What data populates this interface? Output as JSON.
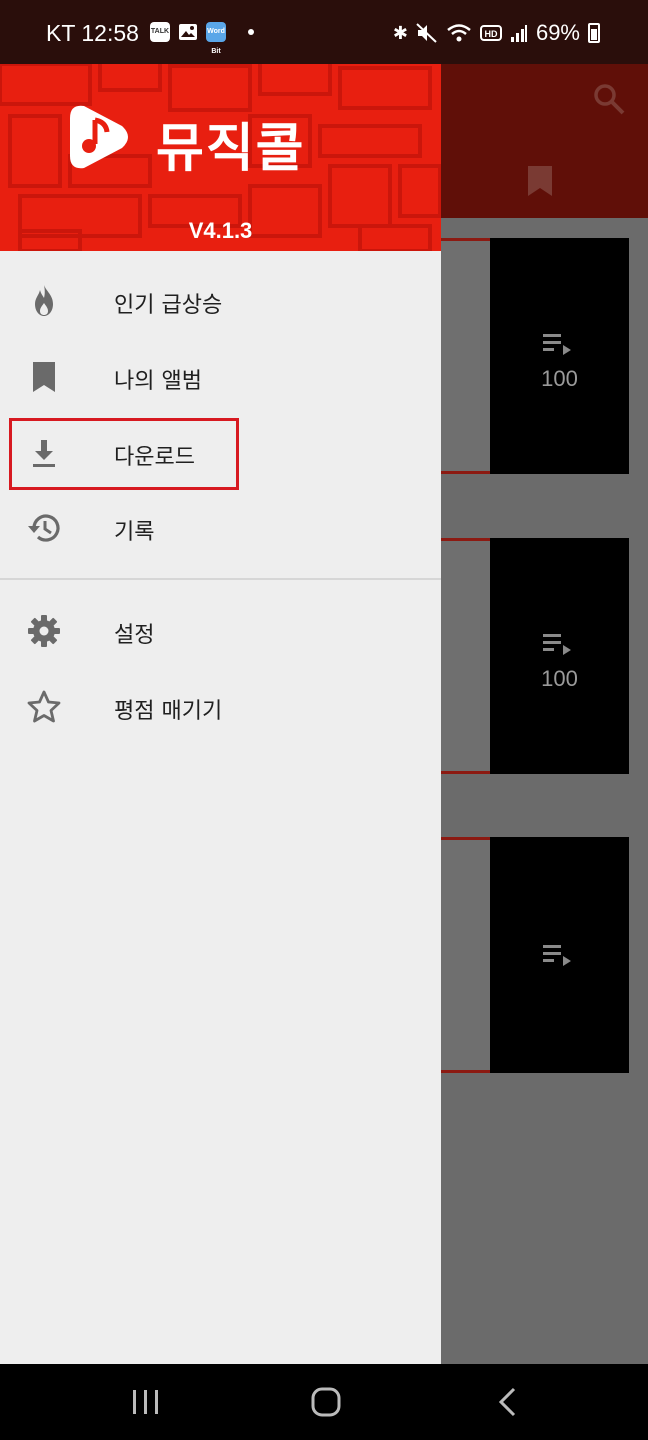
{
  "status_bar": {
    "carrier_time": "KT 12:58",
    "notif_icons": [
      "talk-icon",
      "image-icon",
      "wordbit-icon"
    ],
    "talk_label": "TALK",
    "wordbit_label": "Word Bit",
    "battery": "69%"
  },
  "drawer": {
    "app_name": "뮤직콜",
    "version": "V4.1.3",
    "menu": [
      {
        "label": "인기 급상승",
        "icon": "fire-icon"
      },
      {
        "label": "나의 앨범",
        "icon": "bookmark-icon"
      },
      {
        "label": "다운로드",
        "icon": "download-icon"
      },
      {
        "label": "기록",
        "icon": "history-icon"
      }
    ],
    "menu2": [
      {
        "label": "설정",
        "icon": "gear-icon"
      },
      {
        "label": "평점 매기기",
        "icon": "star-icon"
      }
    ]
  },
  "background": {
    "cards": [
      {
        "count": "100"
      },
      {
        "count": "100"
      },
      {
        "count": ""
      }
    ]
  },
  "colors": {
    "header_red": "#e81f10",
    "highlight": "#d71920",
    "icon_gray": "#6a6a6a"
  }
}
